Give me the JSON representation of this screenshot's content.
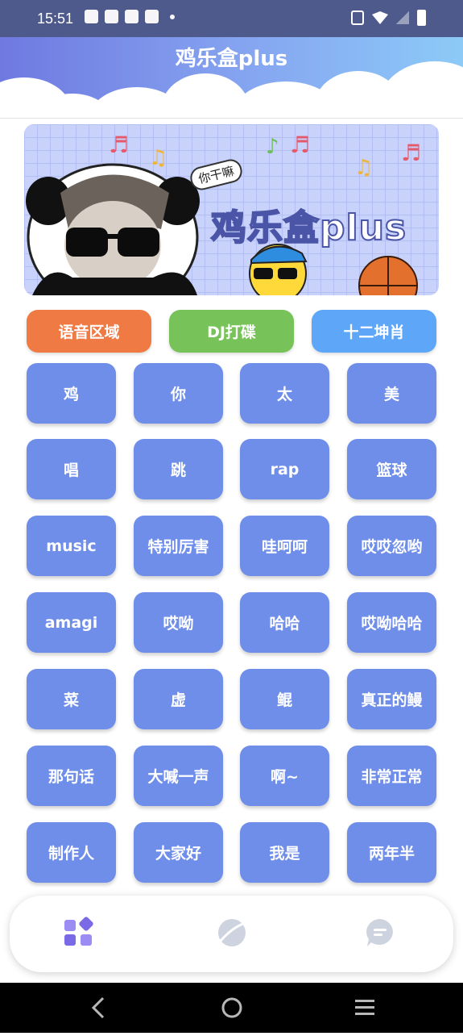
{
  "status_bar": {
    "time": "15:51"
  },
  "header": {
    "title": "鸡乐盒plus"
  },
  "banner": {
    "title": "鸡乐盒plus",
    "bubble": "你干嘛"
  },
  "categories": [
    {
      "label": "语音区域",
      "color": "#ef7a44"
    },
    {
      "label": "DJ打碟",
      "color": "#78c25a"
    },
    {
      "label": "十二坤肖",
      "color": "#5ea6f8"
    }
  ],
  "sound_buttons": [
    [
      "鸡",
      "你",
      "太",
      "美"
    ],
    [
      "唱",
      "跳",
      "rap",
      "篮球"
    ],
    [
      "music",
      "特别厉害",
      "哇呵呵",
      "哎哎忽哟"
    ],
    [
      "amagi",
      "哎呦",
      "哈哈",
      "哎呦哈哈"
    ],
    [
      "菜",
      "虚",
      "鲲",
      "真正的鳗"
    ],
    [
      "那句话",
      "大喊一声",
      "啊~",
      "非常正常"
    ],
    [
      "制作人",
      "大家好",
      "我是",
      "两年半"
    ]
  ],
  "bottom_nav": {
    "items": [
      {
        "icon": "grid-apps-icon",
        "active": true
      },
      {
        "icon": "planet-icon",
        "active": false
      },
      {
        "icon": "chat-bubble-icon",
        "active": false
      }
    ]
  },
  "system_nav": {
    "items": [
      "back-icon",
      "home-icon",
      "recents-icon"
    ]
  },
  "colors": {
    "button_bg": "#6f8eea",
    "header_start": "#6f79e0",
    "header_end": "#8ccaf7"
  }
}
